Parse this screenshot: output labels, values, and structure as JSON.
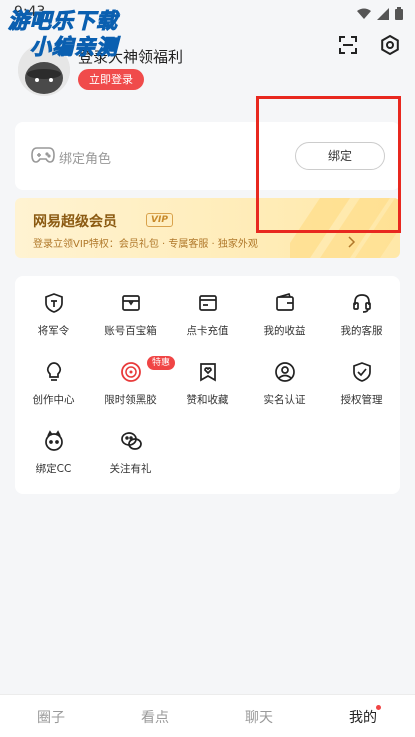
{
  "status_bar": {
    "time": "9:43"
  },
  "watermark": {
    "line1": "游吧乐下载",
    "line2": "小编亲测"
  },
  "profile": {
    "title": "登录大神领福利",
    "login_button": "立即登录"
  },
  "bind": {
    "label": "绑定角色",
    "button": "绑定"
  },
  "vip": {
    "title": "网易超级会员",
    "tag": "VIP",
    "desc": "登录立领VIP特权：会员礼包 · 专属客服 · 独家外观"
  },
  "services": {
    "badge": "特惠",
    "items": [
      {
        "label": "将军令",
        "icon": "shield-t-icon"
      },
      {
        "label": "账号百宝箱",
        "icon": "treasure-box-icon"
      },
      {
        "label": "点卡充值",
        "icon": "card-recharge-icon"
      },
      {
        "label": "我的收益",
        "icon": "wallet-icon"
      },
      {
        "label": "我的客服",
        "icon": "headset-icon"
      },
      {
        "label": "创作中心",
        "icon": "lightbulb-icon"
      },
      {
        "label": "限时领黑胶",
        "icon": "vinyl-icon"
      },
      {
        "label": "赞和收藏",
        "icon": "bookmark-heart-icon"
      },
      {
        "label": "实名认证",
        "icon": "user-circle-icon"
      },
      {
        "label": "授权管理",
        "icon": "shield-check-icon"
      },
      {
        "label": "绑定CC",
        "icon": "cc-icon"
      },
      {
        "label": "关注有礼",
        "icon": "wechat-icon"
      }
    ]
  },
  "bottom_nav": [
    {
      "label": "圈子"
    },
    {
      "label": "看点"
    },
    {
      "label": "聊天"
    },
    {
      "label": "我的",
      "active": true
    }
  ],
  "colors": {
    "accent": "#f04b4b",
    "highlight": "#e8281f",
    "vip_text": "#8b5a12"
  }
}
